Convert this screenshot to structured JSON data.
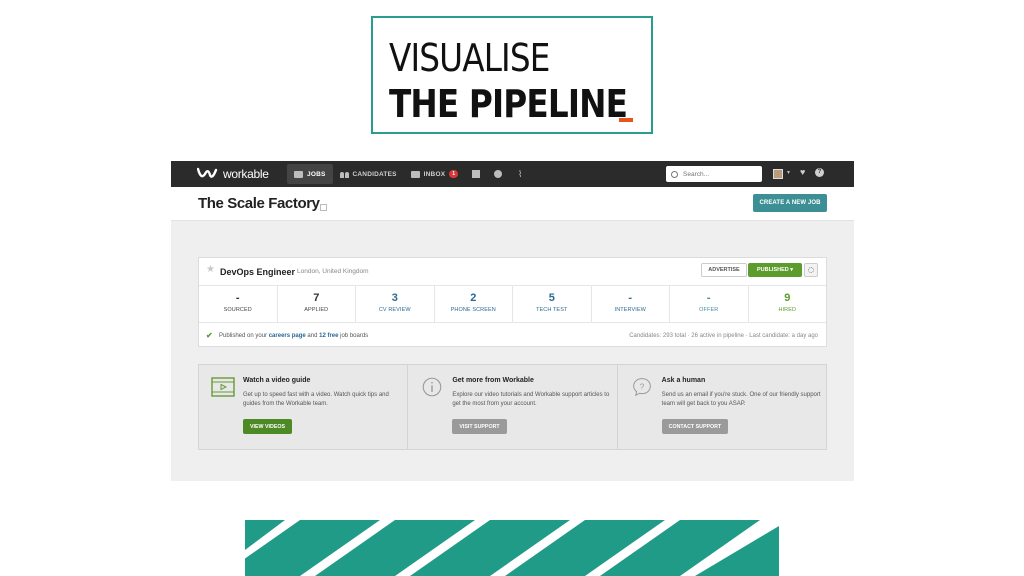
{
  "slide": {
    "title_line1": "VISUALISE",
    "title_line2": "THE PIPELINE",
    "accent_color": "#e8541e",
    "frame_color": "#2a9d8f",
    "stripe_color": "#1f9b87"
  },
  "topbar": {
    "logo_text": "workable",
    "nav": [
      {
        "label": "JOBS",
        "icon": "briefcase-icon",
        "active": true
      },
      {
        "label": "CANDIDATES",
        "icon": "people-icon"
      },
      {
        "label": "INBOX",
        "icon": "envelope-icon",
        "badge": "1"
      }
    ],
    "icon_buttons": [
      "calendar-icon",
      "pie-chart-icon",
      "activity-icon"
    ],
    "search_placeholder": "Search...",
    "caret": "▾",
    "heart": "♥",
    "help": "?"
  },
  "header": {
    "company": "The Scale Factory",
    "create_job_label": "CREATE A NEW JOB",
    "create_job_color": "#3d8f96"
  },
  "job": {
    "title": "DevOps Engineer",
    "location": "London, United Kingdom",
    "advertise_label": "ADVERTISE",
    "published_label": "PUBLISHED ▾",
    "stages": [
      {
        "count": "-",
        "label": "SOURCED"
      },
      {
        "count": "7",
        "label": "APPLIED"
      },
      {
        "count": "3",
        "label": "CV REVIEW"
      },
      {
        "count": "2",
        "label": "PHONE SCREEN"
      },
      {
        "count": "5",
        "label": "TECH TEST"
      },
      {
        "count": "-",
        "label": "INTERVIEW"
      },
      {
        "count": "-",
        "label": "OFFER"
      },
      {
        "count": "9",
        "label": "HIRED"
      }
    ],
    "published_prefix": "Published on your",
    "careers_link": "careers page",
    "published_and": "and",
    "free_link": "12 free",
    "published_suffix": "job boards",
    "stats": "Candidates: 293 total · 26 active in pipeline · Last candidate: a day ago"
  },
  "help": [
    {
      "title": "Watch a video guide",
      "desc": "Get up to speed fast with a video. Watch quick tips and guides from the Workable team.",
      "button": "VIEW VIDEOS",
      "icon": "video-icon"
    },
    {
      "title": "Get more from Workable",
      "desc": "Explore our video tutorials and Workable support articles to get the most from your account.",
      "button": "VISIT SUPPORT",
      "icon": "info-icon"
    },
    {
      "title": "Ask a human",
      "desc": "Send us an email if you're stuck. One of our friendly support team will get back to you ASAP.",
      "button": "CONTACT SUPPORT",
      "icon": "chat-bubble-icon"
    }
  ]
}
